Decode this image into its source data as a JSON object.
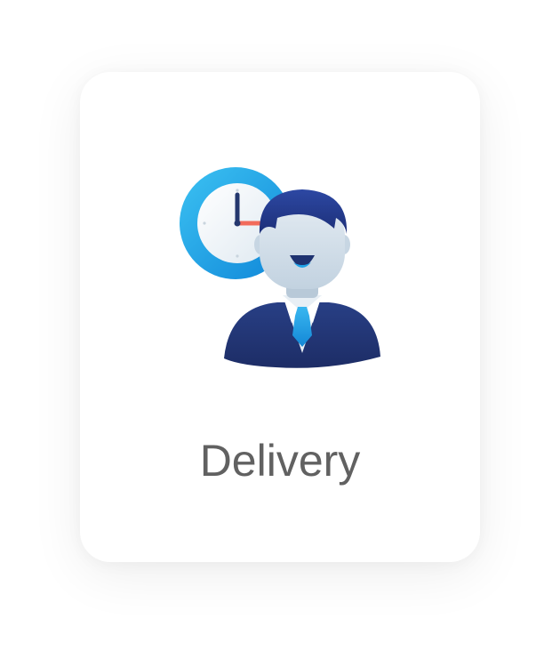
{
  "card": {
    "label": "Delivery",
    "icon": "delivery-agent-clock-icon"
  },
  "colors": {
    "clock_ring": "#1aa6e6",
    "clock_hand": "#24376e",
    "clock_second_hand": "#f26b5b",
    "hair": "#233a8a",
    "suit": "#22356f",
    "tie": "#1e9be0",
    "skin": "#cfdbe6",
    "label_text": "#616161"
  }
}
